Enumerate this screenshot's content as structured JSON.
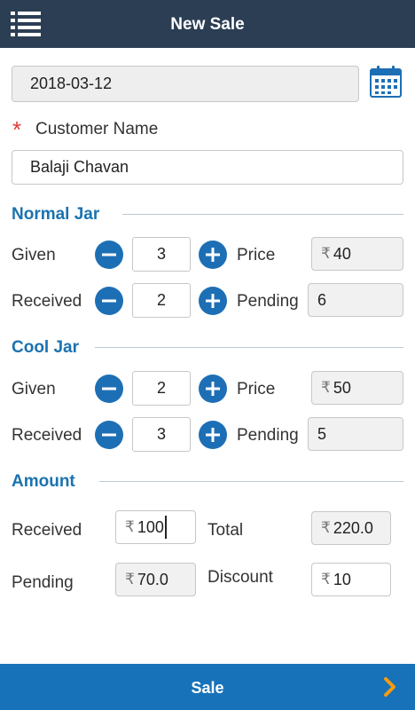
{
  "header": {
    "title": "New Sale",
    "menu_icon": "list-menu-icon"
  },
  "date": {
    "value": "2018-03-12",
    "calendar_icon": "calendar-icon"
  },
  "customer": {
    "required_mark": "*",
    "label": "Customer Name",
    "value": "Balaji Chavan"
  },
  "normal_jar": {
    "title": "Normal Jar",
    "given_label": "Given",
    "given_qty": "3",
    "received_label": "Received",
    "received_qty": "2",
    "price_label": "Price",
    "price": "40",
    "pending_label": "Pending",
    "pending": "6"
  },
  "cool_jar": {
    "title": "Cool Jar",
    "given_label": "Given",
    "given_qty": "2",
    "received_label": "Received",
    "received_qty": "3",
    "price_label": "Price",
    "price": "50",
    "pending_label": "Pending",
    "pending": "5"
  },
  "amount": {
    "title": "Amount",
    "received_label": "Received",
    "received": "100",
    "total_label": "Total",
    "total": "220.0",
    "pending_label": "Pending",
    "pending": "70.0",
    "discount_label": "Discount",
    "discount": "10"
  },
  "currency_symbol": "₹",
  "footer": {
    "label": "Sale",
    "chevron_icon": "chevron-right-icon"
  },
  "colors": {
    "header_bg": "#2c3e54",
    "accent": "#1a72b0",
    "button_blue": "#1d6fb5",
    "footer_bg": "#1872b9",
    "chevron": "#f39c12",
    "required": "#e53935"
  }
}
